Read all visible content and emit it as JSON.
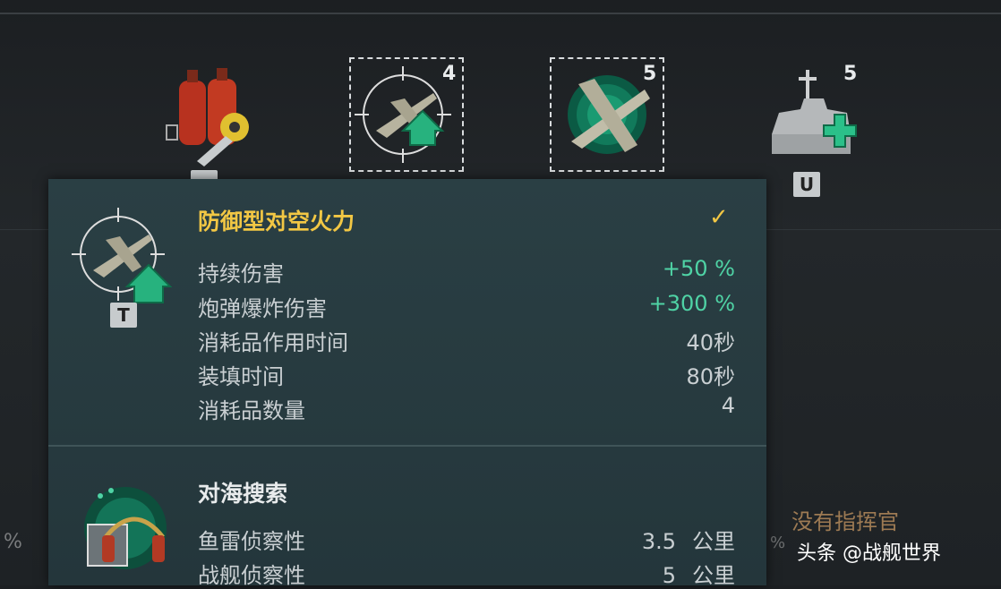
{
  "slots": [
    {
      "name": "repair-party",
      "count": "",
      "key": ""
    },
    {
      "name": "defensive-aa-fire",
      "count": "4",
      "key": "",
      "selected": true
    },
    {
      "name": "catapult-fighter",
      "count": "5",
      "key": "",
      "selected": true
    },
    {
      "name": "repair-consumable",
      "count": "5",
      "key": "U"
    }
  ],
  "tooltip": {
    "section1": {
      "key": "T",
      "title": "防御型对空火力",
      "check": "✓",
      "rows": [
        {
          "label": "持续伤害",
          "value": "+50 %"
        },
        {
          "label": "炮弹爆炸伤害",
          "value": "+300 %"
        },
        {
          "label": "消耗品作用时间",
          "value": "40秒"
        },
        {
          "label": "装填时间",
          "value": "80秒"
        },
        {
          "label": "消耗品数量",
          "value": "4"
        }
      ]
    },
    "section2": {
      "title": "对海搜索",
      "rows": [
        {
          "label": "鱼雷侦察性",
          "value": "3.5",
          "unit": "公里"
        },
        {
          "label": "战舰侦察性",
          "value": "5",
          "unit": "公里"
        }
      ]
    }
  },
  "background": {
    "no_commander": "没有指挥官",
    "left_percent": "%",
    "right_percent": "%"
  },
  "watermark": "头条 @战舰世界",
  "colors": {
    "gold": "#f2c744",
    "green": "#4fd3a5",
    "panel": "#2a3f44"
  }
}
